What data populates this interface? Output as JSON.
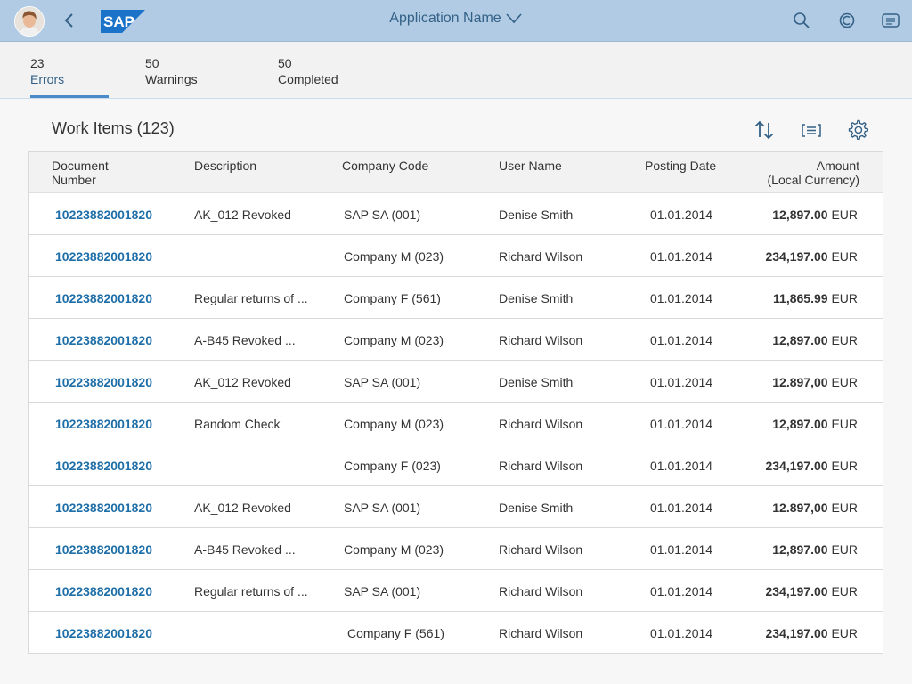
{
  "shell": {
    "app_title": "Application Name",
    "logo_text": "SAP",
    "icons": [
      "back-icon",
      "chevron-down-icon",
      "search-icon",
      "copilot-icon",
      "notifications-icon"
    ]
  },
  "tabs": [
    {
      "count": "23",
      "label": "Errors",
      "active": true
    },
    {
      "count": "50",
      "label": "Warnings",
      "active": false
    },
    {
      "count": "50",
      "label": "Completed",
      "active": false
    }
  ],
  "table": {
    "title": "Work Items (123)",
    "toolbar_icons": [
      "sort-icon",
      "group-icon",
      "settings-icon"
    ],
    "columns": {
      "doc_line1": "Document",
      "doc_line2": "Number",
      "description": "Description",
      "company": "Company Code",
      "user": "User Name",
      "date": "Posting Date",
      "amount_line1": "Amount",
      "amount_line2": "(Local Currency)"
    },
    "rows": [
      {
        "doc": "10223882001820",
        "desc": "AK_012 Revoked",
        "company": "SAP SA (001)",
        "user": "Denise Smith",
        "date": "01.01.2014",
        "amount": "12,897.00",
        "currency": "EUR"
      },
      {
        "doc": "10223882001820",
        "desc": "",
        "company": "Company M (023)",
        "user": "Richard Wilson",
        "date": "01.01.2014",
        "amount": "234,197.00",
        "currency": "EUR"
      },
      {
        "doc": "10223882001820",
        "desc": "Regular returns of ...",
        "company": "Company F (561)",
        "user": "Denise Smith",
        "date": "01.01.2014",
        "amount": "11,865.99",
        "currency": "EUR"
      },
      {
        "doc": "10223882001820",
        "desc": "A-B45 Revoked ...",
        "company": "Company M (023)",
        "user": "Richard Wilson",
        "date": "01.01.2014",
        "amount": "12,897.00",
        "currency": "EUR"
      },
      {
        "doc": "10223882001820",
        "desc": "AK_012 Revoked",
        "company": "SAP SA (001)",
        "user": "Denise Smith",
        "date": "01.01.2014",
        "amount": "12.897,00",
        "currency": "EUR"
      },
      {
        "doc": "10223882001820",
        "desc": "Random Check",
        "company": "Company M (023)",
        "user": "Richard Wilson",
        "date": "01.01.2014",
        "amount": "12,897.00",
        "currency": "EUR"
      },
      {
        "doc": "10223882001820",
        "desc": "",
        "company": "Company F (023)",
        "user": "Richard Wilson",
        "date": "01.01.2014",
        "amount": "234,197.00",
        "currency": "EUR"
      },
      {
        "doc": "10223882001820",
        "desc": "AK_012 Revoked",
        "company": "SAP SA (001)",
        "user": "Denise Smith",
        "date": "01.01.2014",
        "amount": "12.897,00",
        "currency": "EUR"
      },
      {
        "doc": "10223882001820",
        "desc": "A-B45 Revoked ...",
        "company": "Company M (023)",
        "user": "Richard Wilson",
        "date": "01.01.2014",
        "amount": "12,897.00",
        "currency": "EUR"
      },
      {
        "doc": "10223882001820",
        "desc": "Regular returns of ...",
        "company": "SAP SA (001)",
        "user": "Richard Wilson",
        "date": "01.01.2014",
        "amount": "234,197.00",
        "currency": "EUR"
      },
      {
        "doc": "10223882001820",
        "desc": "",
        "company": "Company F (561)",
        "user": "Richard Wilson",
        "date": "01.01.2014",
        "amount": "234,197.00",
        "currency": "EUR"
      }
    ]
  },
  "colors": {
    "shell_bg": "#b0cbe3",
    "accent": "#4a8ac8",
    "link": "#1e6ea8",
    "icon": "#346187"
  }
}
